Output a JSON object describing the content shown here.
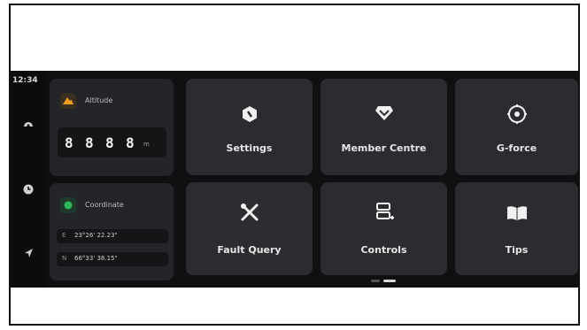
{
  "status": {
    "time": "12:34"
  },
  "rail": {
    "icons": [
      "dashboard-icon",
      "clock-icon",
      "navigation-icon"
    ]
  },
  "altitude": {
    "title": "Altitude",
    "digits": [
      "8",
      "8",
      "8",
      "8"
    ],
    "unit": "m",
    "badge_color": "#f0a020"
  },
  "coordinate": {
    "title": "Coordinate",
    "badge_color": "#2fb85a",
    "rows": [
      {
        "dir": "E",
        "value": "23°26' 22.23\""
      },
      {
        "dir": "N",
        "value": "66°33' 38.15\""
      }
    ]
  },
  "tiles": [
    {
      "label": "Settings",
      "icon": "settings-icon"
    },
    {
      "label": "Member Centre",
      "icon": "member-diamond-icon"
    },
    {
      "label": "G-force",
      "icon": "g-force-icon"
    },
    {
      "label": "Fault Query",
      "icon": "tools-icon"
    },
    {
      "label": "Controls",
      "icon": "controls-icon"
    },
    {
      "label": "Tips",
      "icon": "book-icon"
    }
  ],
  "pager": {
    "pages": 2,
    "active": 2
  }
}
